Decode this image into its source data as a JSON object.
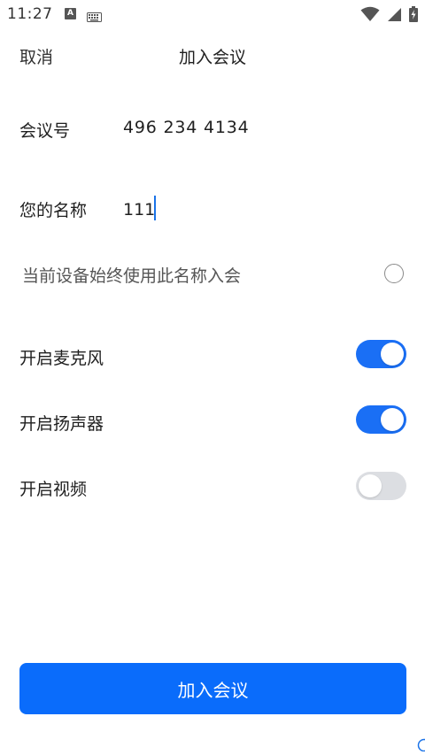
{
  "status_bar": {
    "time": "11:27",
    "notification_letter": "A",
    "icons": [
      "keyboard-icon",
      "wifi-icon",
      "signal-icon",
      "battery-icon"
    ]
  },
  "header": {
    "cancel_label": "取消",
    "title": "加入会议"
  },
  "meeting": {
    "id_label": "会议号",
    "id_value": "496 234 4134"
  },
  "name": {
    "label": "您的名称",
    "value": "111"
  },
  "remember": {
    "label": "当前设备始终使用此名称入会",
    "checked": false
  },
  "options": [
    {
      "label": "开启麦克风",
      "enabled": true
    },
    {
      "label": "开启扬声器",
      "enabled": true
    },
    {
      "label": "开启视频",
      "enabled": false
    }
  ],
  "join_button_label": "加入会议",
  "colors": {
    "accent": "#0a6cfb",
    "toggle_on": "#1a6ff5",
    "toggle_off": "#dcdee2"
  }
}
